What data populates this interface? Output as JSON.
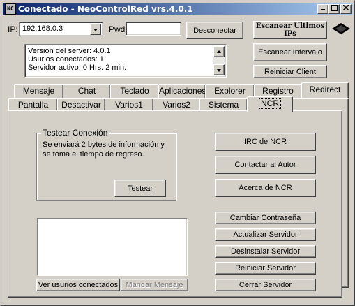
{
  "window": {
    "icon_text": "NC",
    "title": "Conectado - NeoControlRed vrs.4.0.1"
  },
  "connection": {
    "ip_label": "IP:",
    "ip_value": "192.168.0.3",
    "pwd_label": "Pwd:",
    "pwd_value": "",
    "disconnect_label": "Desconectar"
  },
  "side_buttons": {
    "scan_ips": "Escanear Ultimos IPs",
    "scan_interval": "Escanear Intervalo",
    "restart_client": "Reiniciar Client"
  },
  "server_info": {
    "lines": [
      "Version del server: 4.0.1",
      "Usurios conectados: 1",
      "Servidor activo: 0 Hrs. 2 min."
    ]
  },
  "tabs": {
    "back_row": [
      "Mensaje",
      "Chat",
      "Teclado",
      "Aplicaciones",
      "Explorer",
      "Registro",
      "Redirect"
    ],
    "front_row": [
      "Pantalla",
      "Desactivar",
      "Varios1",
      "Varios2",
      "Sistema",
      "NCR"
    ],
    "active": "NCR"
  },
  "ncr": {
    "test_group_title": "Testear Conexión",
    "test_description": "Se enviará 2 bytes de información y se toma el tiempo de regreso.",
    "test_button": "Testear",
    "irc_button": "IRC de NCR",
    "contact_button": "Contactar al Autor",
    "about_button": "Acerca de NCR",
    "change_password": "Cambiar Contraseña",
    "update_server": "Actualizar Servidor",
    "uninstall_server": "Desinstalar Servidor",
    "restart_server": "Reiniciar Servidor",
    "close_server": "Cerrar Servidor",
    "view_users": "Ver usurios conectados",
    "send_message": "Mandar Mensaje"
  }
}
